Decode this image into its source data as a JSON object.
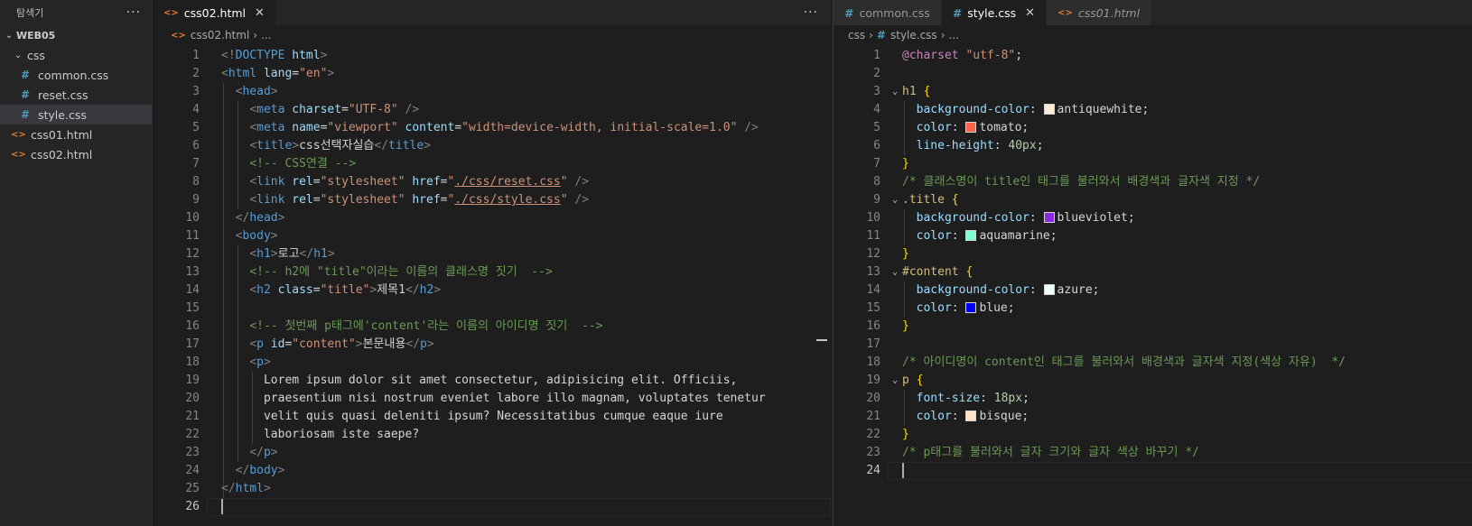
{
  "sidebar": {
    "title": "탐색기",
    "more": "···",
    "root": "WEB05",
    "folder": "css",
    "files_css": [
      "common.css",
      "reset.css",
      "style.css"
    ],
    "files_html": [
      "css01.html",
      "css02.html"
    ]
  },
  "left_editor": {
    "tab": "css02.html",
    "breadcrumb": [
      "css02.html",
      "..."
    ],
    "lines": [
      [
        [
          "t-br",
          "<!"
        ],
        [
          "t-tag",
          "DOCTYPE"
        ],
        [
          "ct",
          " "
        ],
        [
          "t-attr",
          "html"
        ],
        [
          "t-br",
          ">"
        ]
      ],
      [
        [
          "t-br",
          "<"
        ],
        [
          "t-tag",
          "html"
        ],
        [
          "ct",
          " "
        ],
        [
          "t-attr",
          "lang"
        ],
        [
          "ct",
          "="
        ],
        [
          "t-str",
          "\"en\""
        ],
        [
          "t-br",
          ">"
        ]
      ],
      [
        [
          "ct",
          "  "
        ],
        [
          "t-br",
          "<"
        ],
        [
          "t-tag",
          "head"
        ],
        [
          "t-br",
          ">"
        ]
      ],
      [
        [
          "ct",
          "    "
        ],
        [
          "t-br",
          "<"
        ],
        [
          "t-tag",
          "meta"
        ],
        [
          "ct",
          " "
        ],
        [
          "t-attr",
          "charset"
        ],
        [
          "ct",
          "="
        ],
        [
          "t-str",
          "\"UTF-8\""
        ],
        [
          "ct",
          " "
        ],
        [
          "t-br",
          "/>"
        ]
      ],
      [
        [
          "ct",
          "    "
        ],
        [
          "t-br",
          "<"
        ],
        [
          "t-tag",
          "meta"
        ],
        [
          "ct",
          " "
        ],
        [
          "t-attr",
          "name"
        ],
        [
          "ct",
          "="
        ],
        [
          "t-str",
          "\"viewport\""
        ],
        [
          "ct",
          " "
        ],
        [
          "t-attr",
          "content"
        ],
        [
          "ct",
          "="
        ],
        [
          "t-str",
          "\"width=device-width, initial-scale=1.0\""
        ],
        [
          "ct",
          " "
        ],
        [
          "t-br",
          "/>"
        ]
      ],
      [
        [
          "ct",
          "    "
        ],
        [
          "t-br",
          "<"
        ],
        [
          "t-tag",
          "title"
        ],
        [
          "t-br",
          ">"
        ],
        [
          "ct",
          "css선택자실습"
        ],
        [
          "t-br",
          "</"
        ],
        [
          "t-tag",
          "title"
        ],
        [
          "t-br",
          ">"
        ]
      ],
      [
        [
          "ct",
          "    "
        ],
        [
          "t-com",
          "<!-- CSS연결 -->"
        ]
      ],
      [
        [
          "ct",
          "    "
        ],
        [
          "t-br",
          "<"
        ],
        [
          "t-tag",
          "link"
        ],
        [
          "ct",
          " "
        ],
        [
          "t-attr",
          "rel"
        ],
        [
          "ct",
          "="
        ],
        [
          "t-str",
          "\"stylesheet\""
        ],
        [
          "ct",
          " "
        ],
        [
          "t-attr",
          "href"
        ],
        [
          "ct",
          "="
        ],
        [
          "t-str",
          "\""
        ],
        [
          "t-str t-link",
          "./css/reset.css"
        ],
        [
          "t-str",
          "\""
        ],
        [
          "ct",
          " "
        ],
        [
          "t-br",
          "/>"
        ]
      ],
      [
        [
          "ct",
          "    "
        ],
        [
          "t-br",
          "<"
        ],
        [
          "t-tag",
          "link"
        ],
        [
          "ct",
          " "
        ],
        [
          "t-attr",
          "rel"
        ],
        [
          "ct",
          "="
        ],
        [
          "t-str",
          "\"stylesheet\""
        ],
        [
          "ct",
          " "
        ],
        [
          "t-attr",
          "href"
        ],
        [
          "ct",
          "="
        ],
        [
          "t-str",
          "\""
        ],
        [
          "t-str t-link",
          "./css/style.css"
        ],
        [
          "t-str",
          "\""
        ],
        [
          "ct",
          " "
        ],
        [
          "t-br",
          "/>"
        ]
      ],
      [
        [
          "ct",
          "  "
        ],
        [
          "t-br",
          "</"
        ],
        [
          "t-tag",
          "head"
        ],
        [
          "t-br",
          ">"
        ]
      ],
      [
        [
          "ct",
          "  "
        ],
        [
          "t-br",
          "<"
        ],
        [
          "t-tag",
          "body"
        ],
        [
          "t-br",
          ">"
        ]
      ],
      [
        [
          "ct",
          "    "
        ],
        [
          "t-br",
          "<"
        ],
        [
          "t-tag",
          "h1"
        ],
        [
          "t-br",
          ">"
        ],
        [
          "ct",
          "로고"
        ],
        [
          "t-br",
          "</"
        ],
        [
          "t-tag",
          "h1"
        ],
        [
          "t-br",
          ">"
        ]
      ],
      [
        [
          "ct",
          "    "
        ],
        [
          "t-com",
          "<!-- h2에 \"title\"이라는 이름의 클래스명 짓기  -->"
        ]
      ],
      [
        [
          "ct",
          "    "
        ],
        [
          "t-br",
          "<"
        ],
        [
          "t-tag",
          "h2"
        ],
        [
          "ct",
          " "
        ],
        [
          "t-attr",
          "class"
        ],
        [
          "ct",
          "="
        ],
        [
          "t-str",
          "\"title\""
        ],
        [
          "t-br",
          ">"
        ],
        [
          "ct",
          "제목1"
        ],
        [
          "t-br",
          "</"
        ],
        [
          "t-tag",
          "h2"
        ],
        [
          "t-br",
          ">"
        ]
      ],
      [],
      [
        [
          "ct",
          "    "
        ],
        [
          "t-com",
          "<!-- 첫번째 p태그에'content'라는 이름의 아이디명 짓기  -->"
        ]
      ],
      [
        [
          "ct",
          "    "
        ],
        [
          "t-br",
          "<"
        ],
        [
          "t-tag",
          "p"
        ],
        [
          "ct",
          " "
        ],
        [
          "t-attr",
          "id"
        ],
        [
          "ct",
          "="
        ],
        [
          "t-str",
          "\"content\""
        ],
        [
          "t-br",
          ">"
        ],
        [
          "ct",
          "본문내용"
        ],
        [
          "t-br",
          "</"
        ],
        [
          "t-tag",
          "p"
        ],
        [
          "t-br",
          ">"
        ]
      ],
      [
        [
          "ct",
          "    "
        ],
        [
          "t-br",
          "<"
        ],
        [
          "t-tag",
          "p"
        ],
        [
          "t-br",
          ">"
        ]
      ],
      [
        [
          "ct",
          "      Lorem ipsum dolor sit amet consectetur, adipisicing elit. Officiis,"
        ]
      ],
      [
        [
          "ct",
          "      praesentium nisi nostrum eveniet labore illo magnam, voluptates tenetur"
        ]
      ],
      [
        [
          "ct",
          "      velit quis quasi deleniti ipsum? Necessitatibus cumque eaque iure"
        ]
      ],
      [
        [
          "ct",
          "      laboriosam iste saepe?"
        ]
      ],
      [
        [
          "ct",
          "    "
        ],
        [
          "t-br",
          "</"
        ],
        [
          "t-tag",
          "p"
        ],
        [
          "t-br",
          ">"
        ]
      ],
      [
        [
          "ct",
          "  "
        ],
        [
          "t-br",
          "</"
        ],
        [
          "t-tag",
          "body"
        ],
        [
          "t-br",
          ">"
        ]
      ],
      [
        [
          "t-br",
          "</"
        ],
        [
          "t-tag",
          "html"
        ],
        [
          "t-br",
          ">"
        ]
      ],
      []
    ]
  },
  "right_editor": {
    "tabs": [
      {
        "label": "common.css",
        "kind": "css",
        "active": false,
        "italic": false
      },
      {
        "label": "style.css",
        "kind": "css",
        "active": true,
        "italic": false
      },
      {
        "label": "css01.html",
        "kind": "html",
        "active": false,
        "italic": true
      }
    ],
    "breadcrumb": [
      "css",
      "style.css",
      "..."
    ],
    "lines": [
      [
        [
          "t-at",
          "@charset"
        ],
        [
          "ct",
          " "
        ],
        [
          "t-str",
          "\"utf-8\""
        ],
        [
          "ct",
          ";"
        ]
      ],
      [],
      [
        [
          "t-sel",
          "h1"
        ],
        [
          "ct",
          " "
        ],
        [
          "t-brace",
          "{"
        ]
      ],
      [
        [
          "ct",
          "  "
        ],
        [
          "t-prop",
          "background-color"
        ],
        [
          "ct",
          ": "
        ],
        [
          "sw",
          "#faebd7"
        ],
        [
          "ct",
          "antiquewhite;"
        ]
      ],
      [
        [
          "ct",
          "  "
        ],
        [
          "t-prop",
          "color"
        ],
        [
          "ct",
          ": "
        ],
        [
          "sw",
          "#ff6347"
        ],
        [
          "ct",
          "tomato;"
        ]
      ],
      [
        [
          "ct",
          "  "
        ],
        [
          "t-prop",
          "line-height"
        ],
        [
          "ct",
          ": "
        ],
        [
          "t-num",
          "40px"
        ],
        [
          "ct",
          ";"
        ]
      ],
      [
        [
          "t-brace",
          "}"
        ]
      ],
      [
        [
          "t-com",
          "/* 클래스명이 title인 태그를 불러와서 배경색과 글자색 지정 */"
        ]
      ],
      [
        [
          "t-sel",
          ".title"
        ],
        [
          "ct",
          " "
        ],
        [
          "t-brace",
          "{"
        ]
      ],
      [
        [
          "ct",
          "  "
        ],
        [
          "t-prop",
          "background-color"
        ],
        [
          "ct",
          ": "
        ],
        [
          "sw",
          "#8a2be2"
        ],
        [
          "ct",
          "blueviolet;"
        ]
      ],
      [
        [
          "ct",
          "  "
        ],
        [
          "t-prop",
          "color"
        ],
        [
          "ct",
          ": "
        ],
        [
          "sw",
          "#7fffd4"
        ],
        [
          "ct",
          "aquamarine;"
        ]
      ],
      [
        [
          "t-brace",
          "}"
        ]
      ],
      [
        [
          "t-sel",
          "#content"
        ],
        [
          "ct",
          " "
        ],
        [
          "t-brace",
          "{"
        ]
      ],
      [
        [
          "ct",
          "  "
        ],
        [
          "t-prop",
          "background-color"
        ],
        [
          "ct",
          ": "
        ],
        [
          "sw",
          "#f0ffff"
        ],
        [
          "ct",
          "azure;"
        ]
      ],
      [
        [
          "ct",
          "  "
        ],
        [
          "t-prop",
          "color"
        ],
        [
          "ct",
          ": "
        ],
        [
          "sw",
          "#0000ff"
        ],
        [
          "ct",
          "blue;"
        ]
      ],
      [
        [
          "t-brace",
          "}"
        ]
      ],
      [],
      [
        [
          "t-com",
          "/* 아이디명이 content인 태그를 불러와서 배경색과 글자색 지정(색상 자유)  */"
        ]
      ],
      [
        [
          "t-sel",
          "p"
        ],
        [
          "ct",
          " "
        ],
        [
          "t-brace",
          "{"
        ]
      ],
      [
        [
          "ct",
          "  "
        ],
        [
          "t-prop",
          "font-size"
        ],
        [
          "ct",
          ": "
        ],
        [
          "t-num",
          "18px"
        ],
        [
          "ct",
          ";"
        ]
      ],
      [
        [
          "ct",
          "  "
        ],
        [
          "t-prop",
          "color"
        ],
        [
          "ct",
          ": "
        ],
        [
          "sw",
          "#ffe4c4"
        ],
        [
          "ct",
          "bisque;"
        ]
      ],
      [
        [
          "t-brace",
          "}"
        ]
      ],
      [
        [
          "t-com",
          "/* p태그를 불러와서 글자 크기와 글자 색상 바꾸기 */"
        ]
      ],
      []
    ],
    "fold_lines": [
      3,
      9,
      13,
      19
    ]
  }
}
